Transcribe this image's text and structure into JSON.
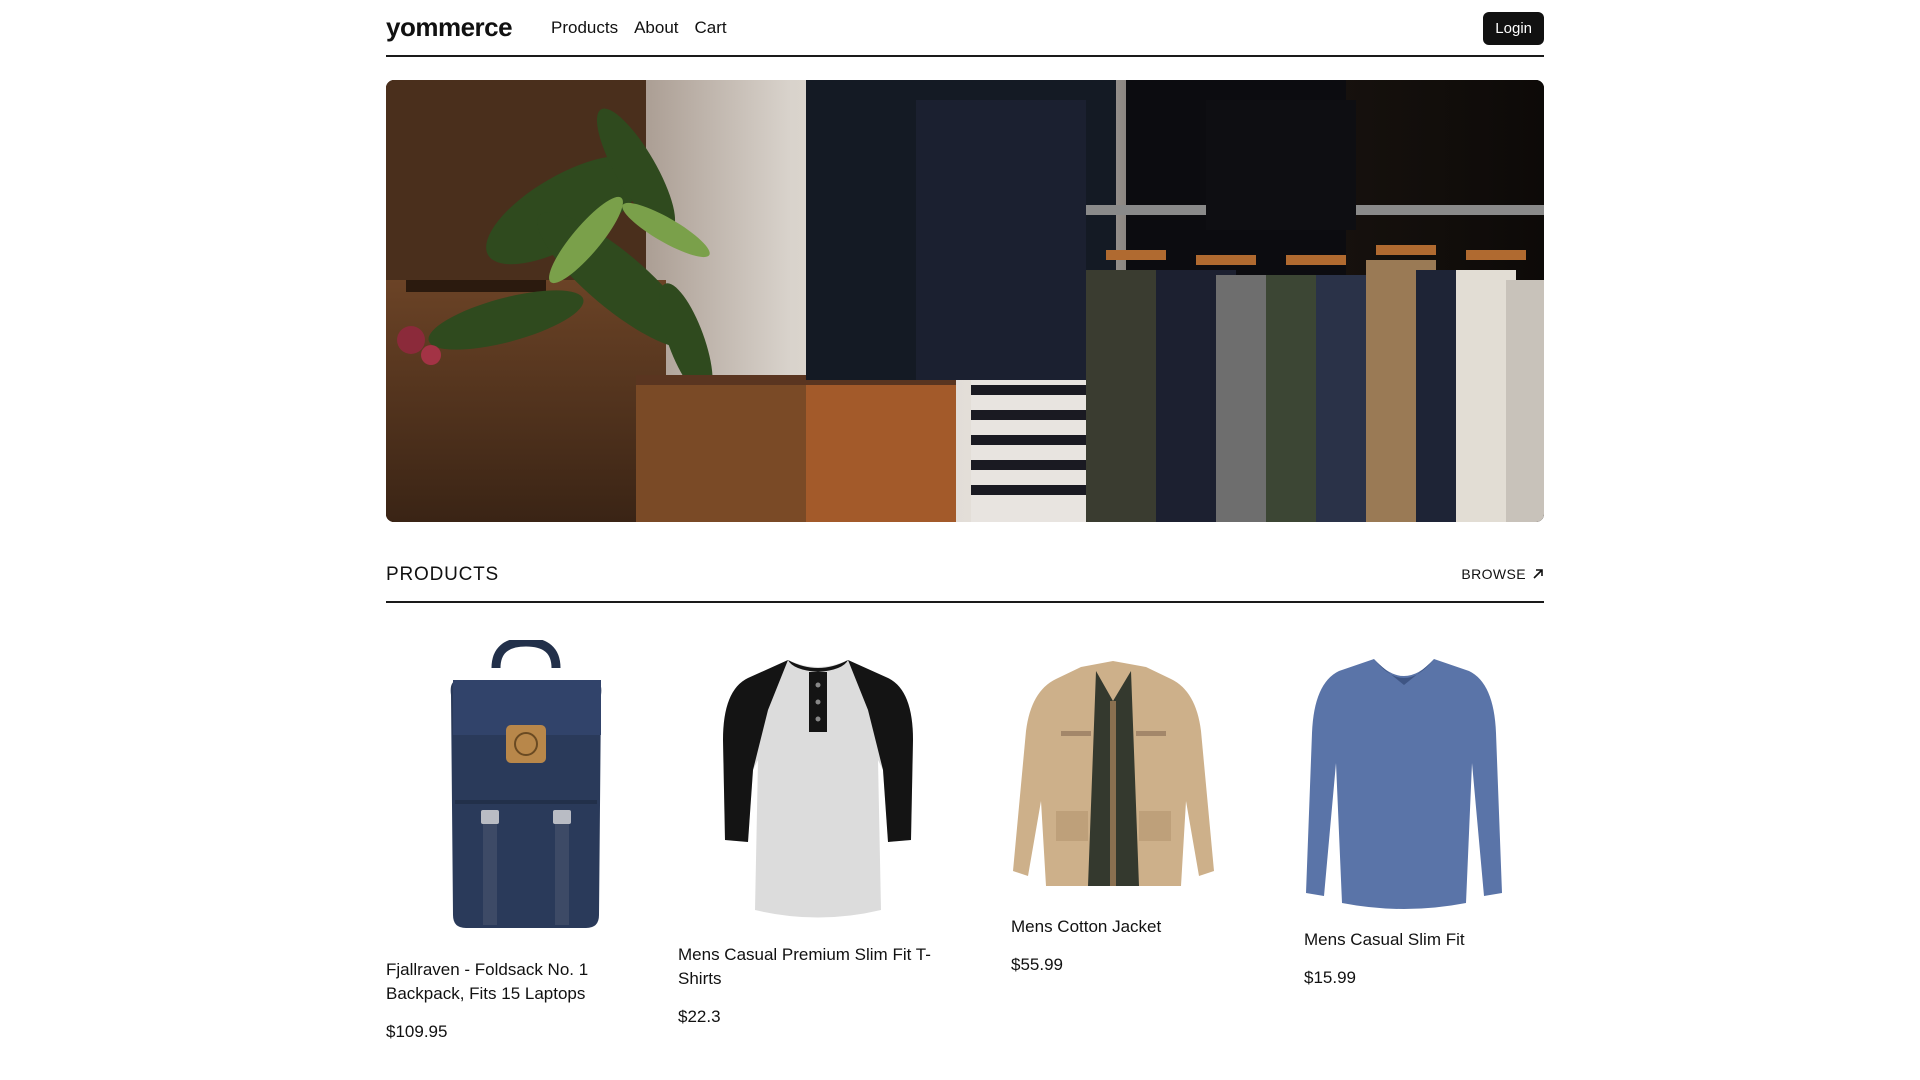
{
  "header": {
    "brand": "yommerce",
    "nav": [
      "Products",
      "About",
      "Cart"
    ],
    "login_label": "Login"
  },
  "hero": {
    "image_icon": "clothing-store-hero-image"
  },
  "products_section": {
    "title": "PRODUCTS",
    "browse_label": "BROWSE",
    "browse_icon": "arrow-up-right-icon",
    "items": [
      {
        "title": "Fjallraven - Foldsack No. 1 Backpack, Fits 15 Laptops",
        "price": "$109.95",
        "image": "navy-backpack"
      },
      {
        "title": "Mens Casual Premium Slim Fit T-Shirts",
        "price": "$22.3",
        "image": "raglan-henley-tshirt"
      },
      {
        "title": "Mens Cotton Jacket",
        "price": "$55.99",
        "image": "khaki-cotton-jacket"
      },
      {
        "title": "Mens Casual Slim Fit",
        "price": "$15.99",
        "image": "blue-longsleeve-shirt"
      }
    ]
  },
  "colors": {
    "text": "#111111",
    "button_bg": "#111111",
    "button_text": "#ffffff",
    "divider": "#1a1a1a"
  }
}
